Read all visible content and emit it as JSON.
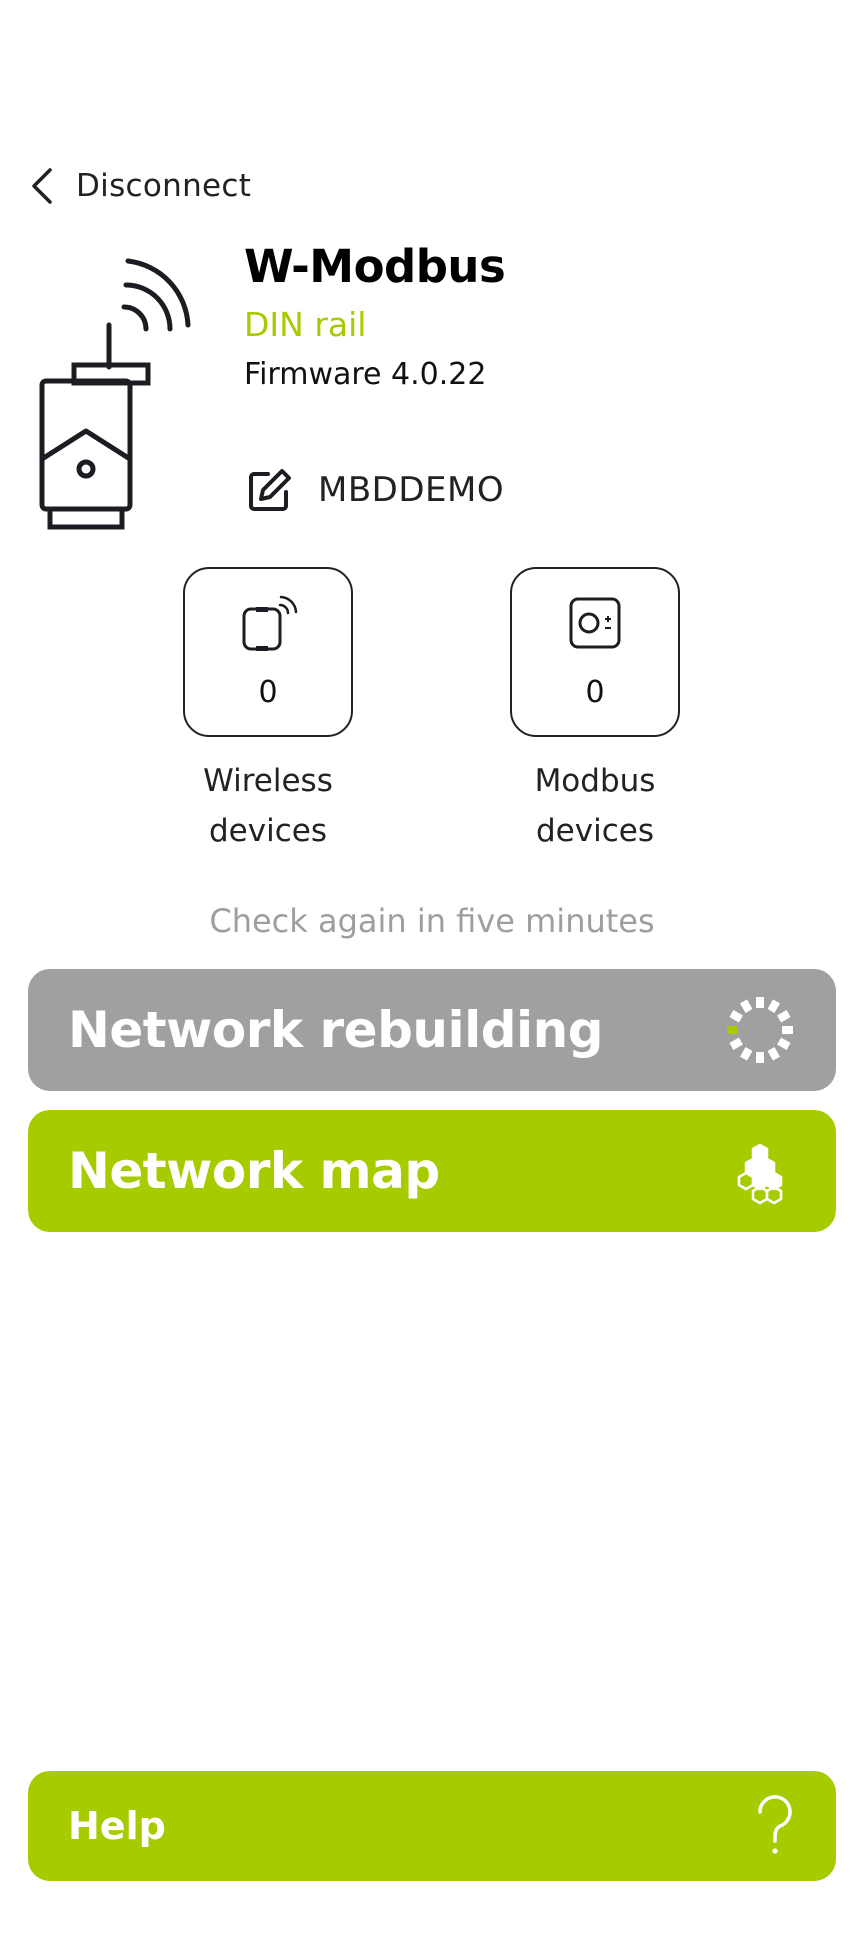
{
  "header": {
    "back_label": "Disconnect",
    "back_icon": "chevron-left-icon"
  },
  "device": {
    "title": "W-Modbus",
    "type": "DIN rail",
    "firmware": "Firmware 4.0.22",
    "name": "MBDDEMO",
    "illustration_icon": "din-rail-gateway-icon",
    "edit_icon": "edit-icon"
  },
  "tiles": [
    {
      "icon": "wireless-device-icon",
      "count": "0",
      "label_line1": "Wireless",
      "label_line2": "devices"
    },
    {
      "icon": "modbus-device-icon",
      "count": "0",
      "label_line1": "Modbus",
      "label_line2": "devices"
    }
  ],
  "hint": "Check again in five minutes",
  "actions": {
    "rebuild": {
      "label": "Network rebuilding",
      "icon": "loading-spinner-icon",
      "enabled": false
    },
    "map": {
      "label": "Network map",
      "icon": "network-map-icon"
    }
  },
  "help": {
    "label": "Help",
    "icon": "question-mark-icon"
  },
  "colors": {
    "accent": "#a6cc00",
    "disabled": "#a0a0a0",
    "hint": "#9e9e9e",
    "text": "#111111",
    "background": "#ffffff"
  }
}
